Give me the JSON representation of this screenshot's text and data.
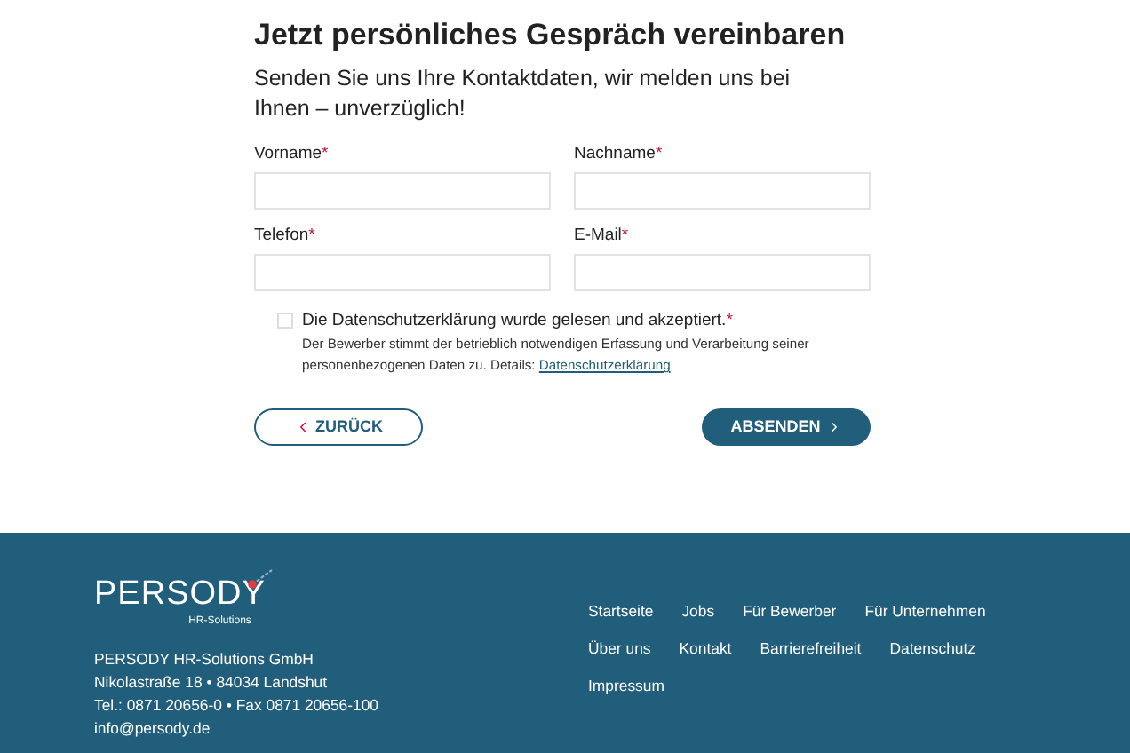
{
  "form": {
    "title": "Jetzt persönliches Gespräch vereinbaren",
    "intro": "Senden Sie uns Ihre Kontaktdaten, wir melden uns bei Ihnen – unverzüglich!",
    "fields": [
      {
        "label": "Vorname",
        "required_mark": "*"
      },
      {
        "label": "Nachname",
        "required_mark": "*"
      },
      {
        "label": "Telefon",
        "required_mark": "*"
      },
      {
        "label": "E-Mail",
        "required_mark": "*"
      }
    ],
    "consent": {
      "checked": false,
      "label": "Die Datenschutzerklärung wurde gelesen und akzeptiert.",
      "required_mark": "*",
      "text": "Der Bewerber stimmt der betrieblich notwendigen Erfassung und Verarbeitung seiner personenbezogenen Daten zu. Details:",
      "link": "Datenschutzerklärung"
    },
    "back_button": "ZURÜCK",
    "submit_button": "ABSENDEN"
  },
  "footer": {
    "logo": {
      "name": "PERSODY",
      "tagline": "HR-Solutions"
    },
    "address": [
      "PERSODY HR-Solutions GmbH",
      "Nikolastraße 18 • 84034 Landshut",
      "Tel.: 0871 20656-0 • Fax 0871 20656-100",
      "info@persody.de"
    ],
    "link_rows": [
      [
        "Startseite",
        "Jobs",
        "Für Bewerber",
        "Für Unternehmen"
      ],
      [
        "Über uns",
        "Kontakt",
        "Barrierefreiheit",
        "Datenschutz"
      ],
      [
        "Impressum"
      ]
    ]
  }
}
